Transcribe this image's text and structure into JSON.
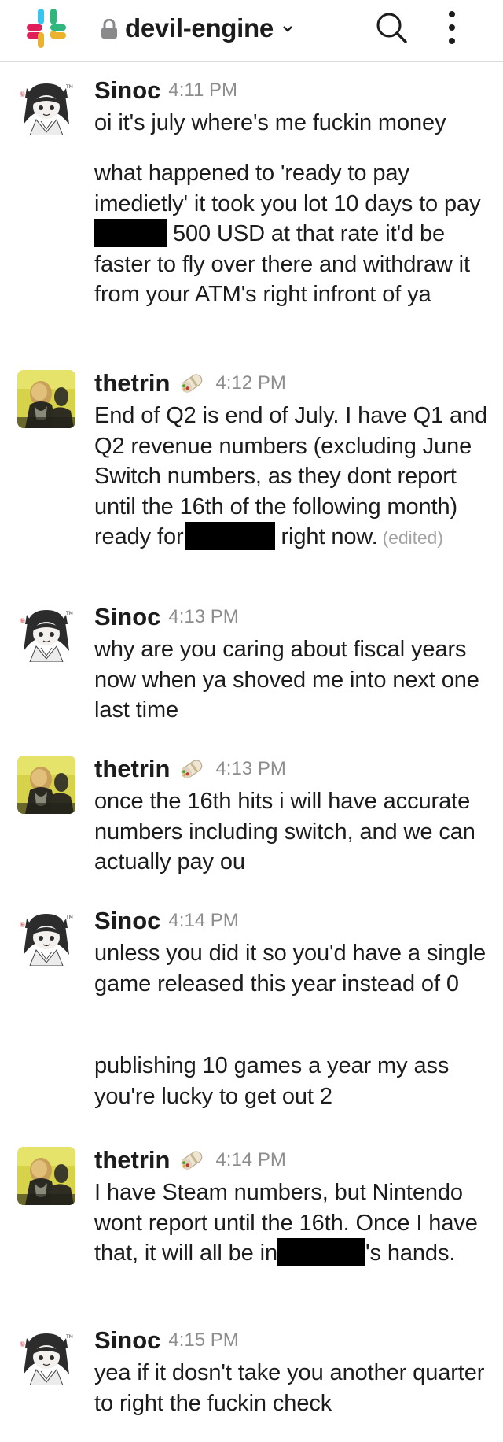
{
  "header": {
    "channel": "devil-engine",
    "logo_icon": "slack-logo-icon",
    "lock_icon": "lock-icon",
    "chevron_icon": "chevron-down-icon",
    "search_icon": "search-icon",
    "more_icon": "more-vertical-icon"
  },
  "colors": {
    "text": "#1d1c1d",
    "time": "#8d8d8f",
    "divider": "#dcdcdc",
    "redaction": "#000000"
  },
  "messages": [
    {
      "author": "Sinoc",
      "time": "4:11 PM",
      "avatar": "anime-avatar",
      "lines": [
        [
          "oi it's july where's me fuckin money"
        ],
        [
          "what happened to 'ready to pay imedietly' it took you lot 10 days to pay",
          " 500 USD at that rate it'd be faster to fly over there and withdraw it from your ATM's right infront of ya"
        ]
      ]
    },
    {
      "author": "thetrin",
      "time": "4:12 PM",
      "avatar": "photo-avatar",
      "status_icon": "burrito-icon",
      "lines": [
        [
          "End of Q2 is end of July. I have Q1 and Q2 revenue numbers (excluding June Switch numbers, as they dont report until the 16th of the following month) ready for",
          "right now."
        ]
      ],
      "edited": "(edited)"
    },
    {
      "author": "Sinoc",
      "time": "4:13 PM",
      "avatar": "anime-avatar",
      "lines": [
        [
          "why are you caring about fiscal years now when ya shoved me into next one last time"
        ]
      ]
    },
    {
      "author": "thetrin",
      "time": "4:13 PM",
      "avatar": "photo-avatar",
      "status_icon": "burrito-icon",
      "lines": [
        [
          "once the 16th hits i will have accurate numbers including switch, and we can actually pay ou"
        ]
      ]
    },
    {
      "author": "Sinoc",
      "time": "4:14 PM",
      "avatar": "anime-avatar",
      "lines": [
        [
          "unless you did it so you'd have a single game released this year instead of 0"
        ],
        [
          "publishing 10 games a year my ass you're lucky to get out 2"
        ]
      ]
    },
    {
      "author": "thetrin",
      "time": "4:14 PM",
      "avatar": "photo-avatar",
      "status_icon": "burrito-icon",
      "lines": [
        [
          "I have Steam numbers, but Nintendo wont report until the 16th. Once I have that, it will all be in",
          "'s hands."
        ]
      ]
    },
    {
      "author": "Sinoc",
      "time": "4:15 PM",
      "avatar": "anime-avatar",
      "lines": [
        [
          "yea if it dosn't take you another quarter to right the fuckin check"
        ]
      ]
    }
  ]
}
